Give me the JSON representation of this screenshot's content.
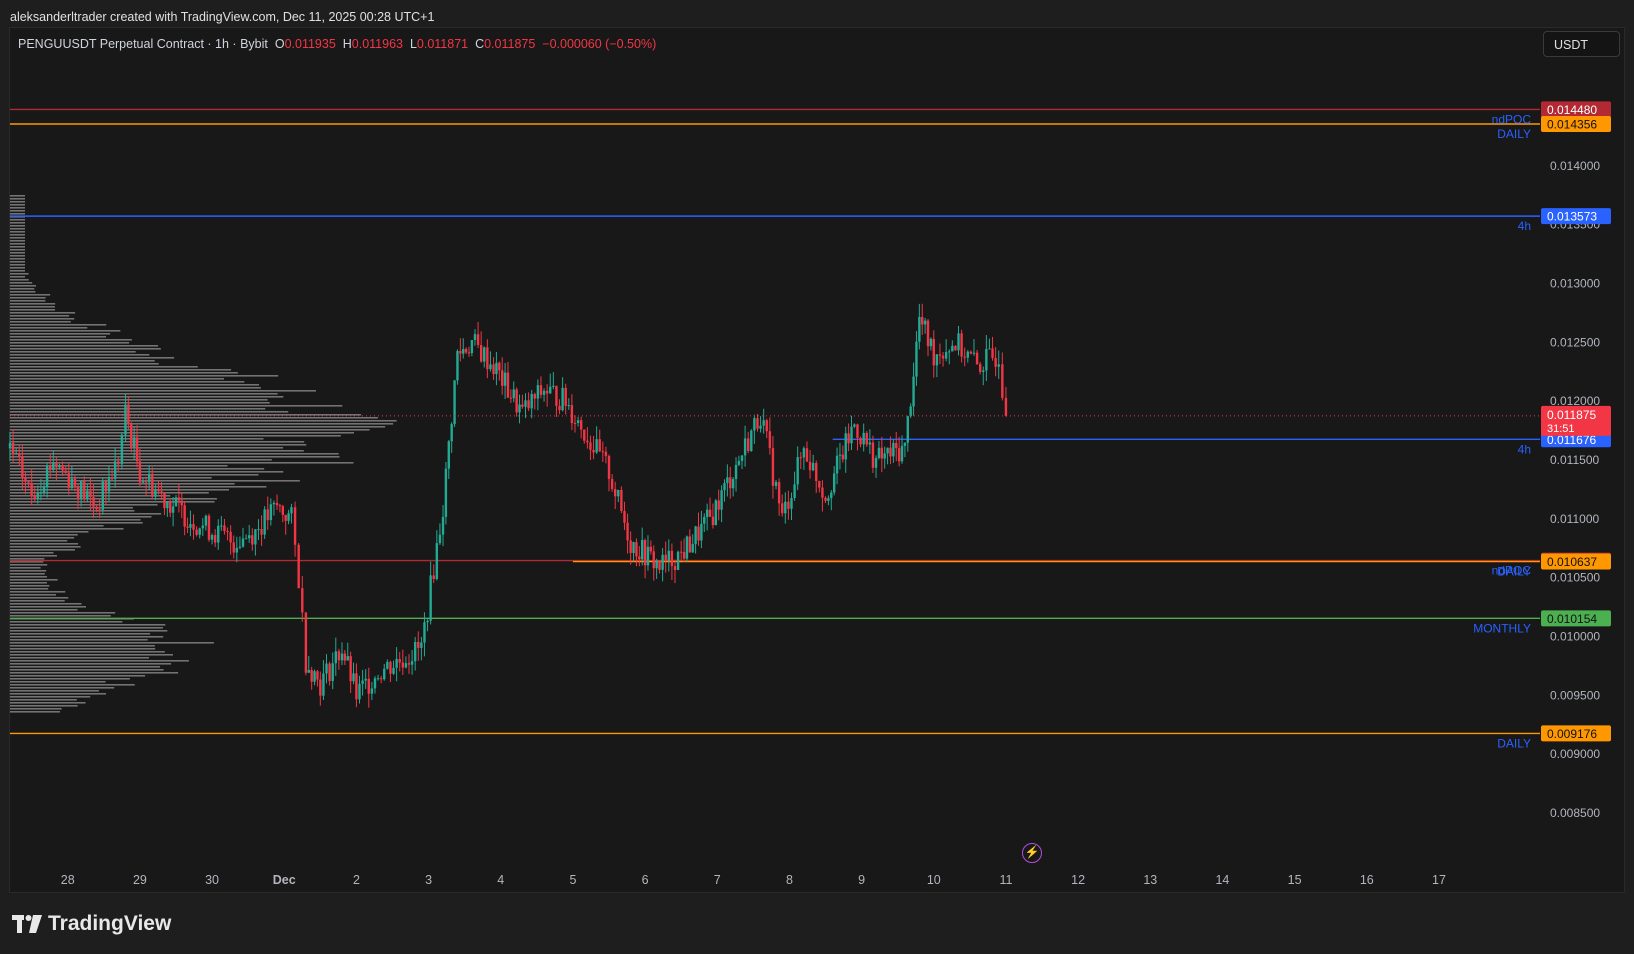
{
  "attribution": "aleksanderltrader created with TradingView.com, Dec 11, 2025 00:28 UTC+1",
  "legend": {
    "symbol": "PENGUUSDT Perpetual Contract · 1h · Bybit",
    "o_label": "O",
    "o_value": "0.011935",
    "h_label": "H",
    "h_value": "0.011963",
    "l_label": "L",
    "l_value": "0.011871",
    "c_label": "C",
    "c_value": "0.011875",
    "change": "−0.000060 (−0.50%)"
  },
  "currency_button": "USDT",
  "footer": {
    "brand": "TradingView"
  },
  "colors": {
    "up": "#22ab94",
    "down": "#f23645",
    "blue": "#2962ff",
    "orange": "#ff9800",
    "green": "#4caf50",
    "darkred": "#b22833"
  },
  "chart_data": {
    "type": "candlestick",
    "title": "PENGUUSDT Perpetual Contract · 1h · Bybit",
    "ylim": [
      0.0081,
      0.0149
    ],
    "price_ticks": [
      "0.014000",
      "0.013500",
      "0.013000",
      "0.012500",
      "0.012000",
      "0.011500",
      "0.011000",
      "0.010500",
      "0.010000",
      "0.009500",
      "0.009000",
      "0.008500"
    ],
    "x_labels": [
      "28",
      "29",
      "30",
      "Dec",
      "2",
      "3",
      "4",
      "5",
      "6",
      "7",
      "8",
      "9",
      "10",
      "11",
      "12",
      "13",
      "14",
      "15",
      "16",
      "17"
    ],
    "x_label_days": [
      28,
      29,
      30,
      31,
      32,
      33,
      34,
      35,
      36,
      37,
      38,
      39,
      40,
      41,
      42,
      43,
      44,
      45,
      46,
      47
    ],
    "x_range_days": [
      27.2,
      48.4
    ],
    "last_price": {
      "value": "0.011875",
      "countdown": "31:51"
    },
    "levels": [
      {
        "price": 0.01448,
        "label": "0.014480",
        "color": "#b22833",
        "tag": "ndPOC",
        "start_day": 27.2
      },
      {
        "price": 0.014356,
        "label": "0.014356",
        "color": "#ff9800",
        "tag": "DAILY",
        "start_day": 27.2
      },
      {
        "price": 0.013573,
        "label": "0.013573",
        "color": "#2962ff",
        "tag": "4h",
        "start_day": 27.2
      },
      {
        "price": 0.011676,
        "label": "0.011676",
        "color": "#2962ff",
        "tag": "4h",
        "start_day": 38.6
      },
      {
        "price": 0.010645,
        "label": "0.010645",
        "color": "#b22833",
        "tag": "ndPOC",
        "start_day": 27.2
      },
      {
        "price": 0.010637,
        "label": "0.010637",
        "color": "#ff9800",
        "tag": "DAILY",
        "start_day": 35.0
      },
      {
        "price": 0.010154,
        "label": "0.010154",
        "color": "#4caf50",
        "tag": "MONTHLY",
        "start_day": 27.2
      },
      {
        "price": 0.009176,
        "label": "0.009176",
        "color": "#ff9800",
        "tag": "DAILY",
        "start_day": 27.2
      }
    ],
    "price_path": [
      [
        27.2,
        0.0116
      ],
      [
        27.5,
        0.0112
      ],
      [
        27.8,
        0.0115
      ],
      [
        28.1,
        0.0113
      ],
      [
        28.4,
        0.0111
      ],
      [
        28.7,
        0.0115
      ],
      [
        28.8,
        0.0119
      ],
      [
        29.0,
        0.0114
      ],
      [
        29.3,
        0.0112
      ],
      [
        29.7,
        0.011
      ],
      [
        30.0,
        0.0109
      ],
      [
        30.3,
        0.0108
      ],
      [
        30.6,
        0.0109
      ],
      [
        30.9,
        0.0111
      ],
      [
        31.1,
        0.011
      ],
      [
        31.2,
        0.0105
      ],
      [
        31.3,
        0.0098
      ],
      [
        31.5,
        0.0096
      ],
      [
        31.8,
        0.0099
      ],
      [
        32.0,
        0.0095
      ],
      [
        32.3,
        0.0097
      ],
      [
        32.6,
        0.0098
      ],
      [
        32.9,
        0.0099
      ],
      [
        33.2,
        0.0111
      ],
      [
        33.4,
        0.0124
      ],
      [
        33.6,
        0.0125
      ],
      [
        33.9,
        0.0123
      ],
      [
        34.3,
        0.0119
      ],
      [
        34.6,
        0.0121
      ],
      [
        34.9,
        0.012
      ],
      [
        35.2,
        0.0117
      ],
      [
        35.5,
        0.0114
      ],
      [
        35.8,
        0.0108
      ],
      [
        36.2,
        0.0106
      ],
      [
        36.5,
        0.0107
      ],
      [
        36.9,
        0.011
      ],
      [
        37.3,
        0.0115
      ],
      [
        37.6,
        0.0119
      ],
      [
        37.9,
        0.011
      ],
      [
        38.2,
        0.0116
      ],
      [
        38.5,
        0.0112
      ],
      [
        38.9,
        0.0118
      ],
      [
        39.2,
        0.0115
      ],
      [
        39.6,
        0.0116
      ],
      [
        39.8,
        0.0127
      ],
      [
        40.0,
        0.0124
      ],
      [
        40.3,
        0.0125
      ],
      [
        40.6,
        0.0123
      ],
      [
        40.9,
        0.0124
      ],
      [
        41.0,
        0.011875
      ]
    ]
  }
}
